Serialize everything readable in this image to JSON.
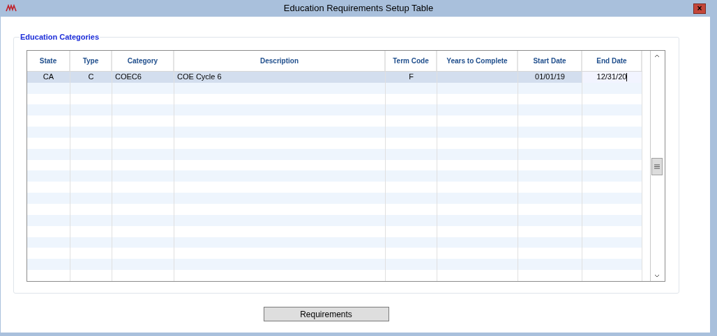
{
  "window": {
    "title": "Education Requirements Setup Table",
    "close": "×"
  },
  "group": {
    "title": "Education Categories"
  },
  "table": {
    "columns": [
      "State",
      "Type",
      "Category",
      "Description",
      "Term Code",
      "Years to Complete",
      "Start Date",
      "End Date"
    ],
    "rows": [
      {
        "selected": true,
        "cells": [
          {
            "text": "CA",
            "editing": false
          },
          {
            "text": "C",
            "editing": false
          },
          {
            "text": "COEC6",
            "editing": false
          },
          {
            "text": "COE Cycle 6",
            "editing": false
          },
          {
            "text": "F",
            "editing": false
          },
          {
            "text": "",
            "editing": false
          },
          {
            "text": "01/01/19",
            "editing": false
          },
          {
            "text": "12/31/20",
            "editing": true
          }
        ]
      }
    ]
  },
  "buttons": [
    "Requirements"
  ]
}
